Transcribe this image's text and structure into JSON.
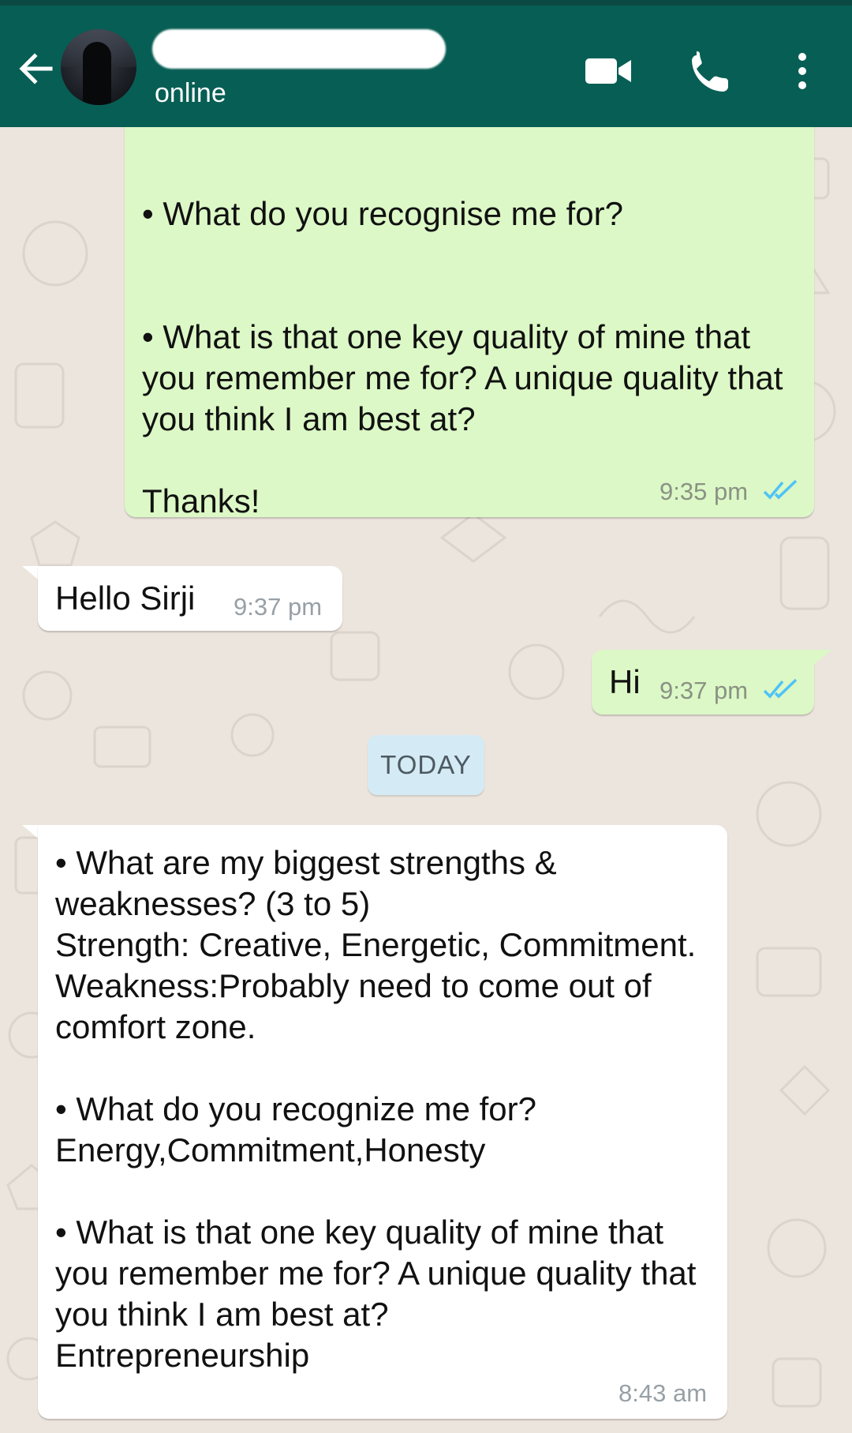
{
  "header": {
    "contact_name": "",
    "status": "online",
    "icons": {
      "back": "back-arrow-icon",
      "video": "video-call-icon",
      "call": "phone-icon",
      "menu": "more-vert-icon"
    }
  },
  "messages": [
    {
      "direction": "outgoing",
      "text": "• What do you recognise me for?\n\n\n• What is that one key quality of mine that you remember me for? A unique quality that you think I am best at?\n\nThanks!",
      "time": "9:35 pm",
      "read": true
    },
    {
      "direction": "incoming",
      "text": "Hello Sirji",
      "time": "9:37 pm"
    },
    {
      "direction": "outgoing",
      "text": "Hi",
      "time": "9:37 pm",
      "read": true
    },
    {
      "direction": "incoming",
      "text": "• What are my biggest strengths & weaknesses? (3 to 5)\nStrength: Creative, Energetic, Commitment.\nWeakness:Probably need to come out of comfort zone.\n\n• What do you recognize me for?\nEnergy,Commitment,Honesty\n\n• What is that one key quality of mine that you remember me for? A unique quality that you think I am best at?\nEntrepreneurship",
      "time": "8:43 am"
    }
  ],
  "date_divider": "TODAY",
  "colors": {
    "header": "#075e54",
    "outgoing_bubble": "#dcf8c6",
    "incoming_bubble": "#ffffff",
    "background": "#ece5dd",
    "read_ticks": "#4fc3f7",
    "date_chip": "#d4eaf4"
  }
}
